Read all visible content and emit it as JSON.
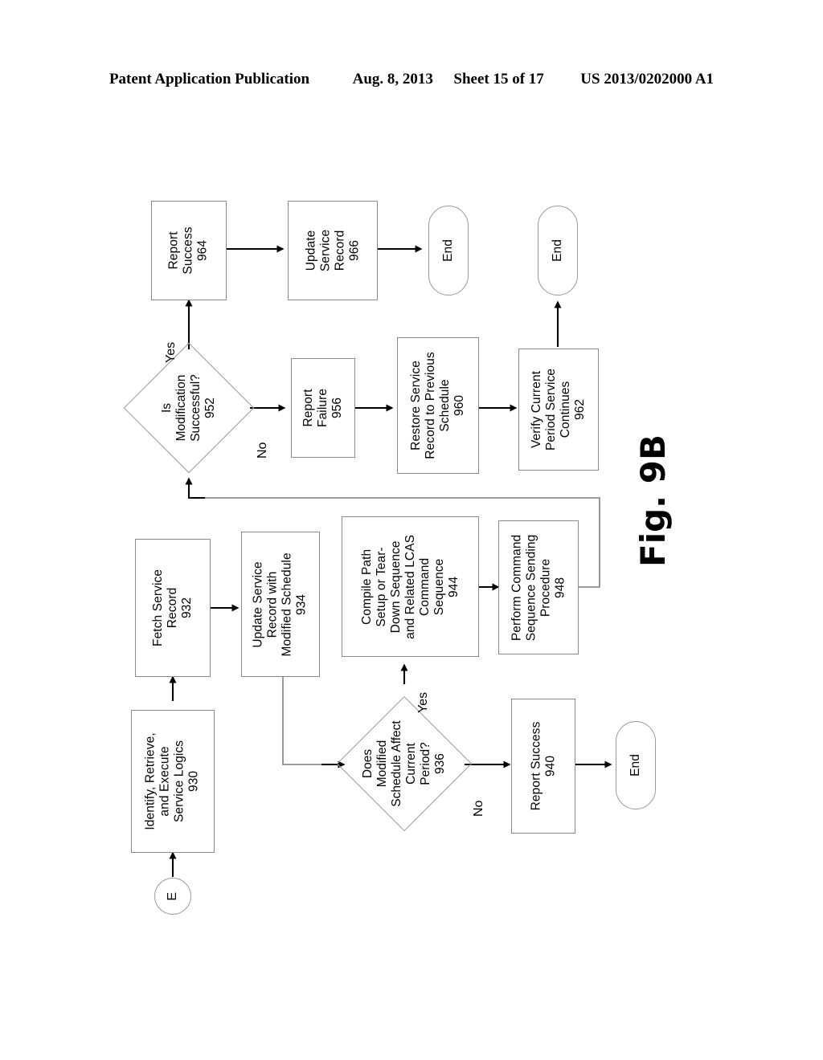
{
  "header": {
    "publication": "Patent Application Publication",
    "date": "Aug. 8, 2013",
    "sheet": "Sheet 15 of 17",
    "patent_number": "US 2013/0202000 A1"
  },
  "figure": {
    "caption": "Fig. 9B"
  },
  "diagram": {
    "type": "flowchart",
    "orientation": "rotated-90-ccw",
    "nodes": [
      {
        "id": "930",
        "shape": "process",
        "label": "Identify, Retrieve,\nand Execute\nService Logics\n930"
      },
      {
        "id": "932",
        "shape": "process",
        "label": "Fetch Service\nRecord\n932"
      },
      {
        "id": "934",
        "shape": "process",
        "label": "Update Service\nRecord with\nModified Schedule\n934"
      },
      {
        "id": "936",
        "shape": "decision",
        "label": "Does\nModified\nSchedule Affect\nCurrent\nPeriod?\n936"
      },
      {
        "id": "940",
        "shape": "process",
        "label": "Report Success\n940"
      },
      {
        "id": "944",
        "shape": "process",
        "label": "Compile Path\nSetup or Tear-\nDown Sequence\nand Related LCAS\nCommand\nSequence\n944"
      },
      {
        "id": "948",
        "shape": "process",
        "label": "Perform Command\nSequence Sending\nProcedure\n948"
      },
      {
        "id": "952",
        "shape": "decision",
        "label": "Is\nModification\nSuccessful?\n952"
      },
      {
        "id": "956",
        "shape": "process",
        "label": "Report\nFailure\n956"
      },
      {
        "id": "960",
        "shape": "process",
        "label": "Restore Service\nRecord to Previous\nSchedule\n960"
      },
      {
        "id": "962",
        "shape": "process",
        "label": "Verify Current\nPeriod Service\nContinues\n962"
      },
      {
        "id": "964",
        "shape": "process",
        "label": "Report\nSuccess\n964"
      },
      {
        "id": "966",
        "shape": "process",
        "label": "Update\nService\nRecord\n966"
      },
      {
        "id": "entry_E",
        "shape": "connector",
        "label": "E"
      },
      {
        "id": "end_940",
        "shape": "terminator",
        "label": "End"
      },
      {
        "id": "end_962",
        "shape": "terminator",
        "label": "End"
      },
      {
        "id": "end_966",
        "shape": "terminator",
        "label": "End"
      }
    ],
    "edge_labels": {
      "d936_yes": "Yes",
      "d936_no": "No",
      "d952_yes": "Yes",
      "d952_no": "No"
    },
    "edges": [
      {
        "from": "entry_E",
        "to": "930",
        "label": ""
      },
      {
        "from": "930",
        "to": "932",
        "label": ""
      },
      {
        "from": "932",
        "to": "934",
        "label": ""
      },
      {
        "from": "934",
        "to": "936",
        "label": ""
      },
      {
        "from": "936",
        "to": "944",
        "label": "Yes"
      },
      {
        "from": "936",
        "to": "940",
        "label": "No"
      },
      {
        "from": "940",
        "to": "end_940",
        "label": ""
      },
      {
        "from": "944",
        "to": "948",
        "label": ""
      },
      {
        "from": "948",
        "to": "952",
        "label": ""
      },
      {
        "from": "952",
        "to": "964",
        "label": "Yes"
      },
      {
        "from": "952",
        "to": "956",
        "label": "No"
      },
      {
        "from": "964",
        "to": "966",
        "label": ""
      },
      {
        "from": "966",
        "to": "end_966",
        "label": ""
      },
      {
        "from": "956",
        "to": "960",
        "label": ""
      },
      {
        "from": "960",
        "to": "962",
        "label": ""
      },
      {
        "from": "962",
        "to": "end_962",
        "label": ""
      }
    ]
  }
}
